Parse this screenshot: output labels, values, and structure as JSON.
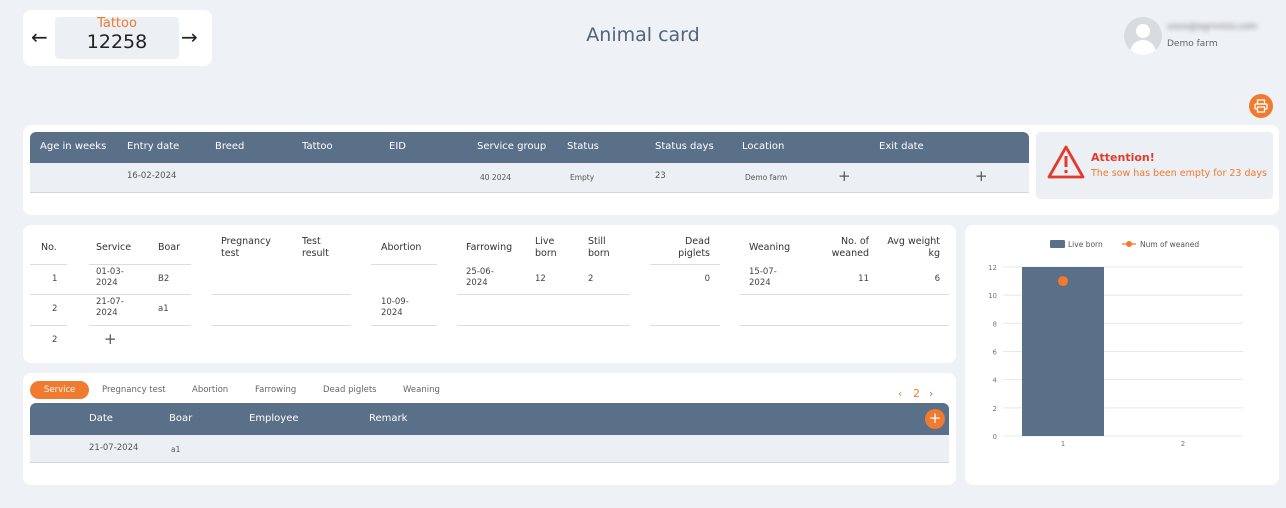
{
  "header": {
    "tattoo_label": "Tattoo",
    "tattoo_value": "12258",
    "title": "Animal card",
    "user_email": "xxxx@agrivisio.com",
    "farm": "Demo farm"
  },
  "info": {
    "columns": [
      "Age in weeks",
      "Entry date",
      "Breed",
      "Tattoo",
      "EID",
      "Service group",
      "Status",
      "Status days",
      "Location",
      "Exit date"
    ],
    "row": {
      "age": "",
      "entry_date": "16-02-2024",
      "breed": "",
      "tattoo": "",
      "eid": "",
      "service_group": "40 2024",
      "status": "Empty",
      "status_days": "23",
      "location": "Demo farm",
      "exit_date": ""
    }
  },
  "alert": {
    "title": "Attention!",
    "message": "The sow has been empty for 23 days"
  },
  "repro": {
    "headers": {
      "no": "No.",
      "service": "Service",
      "boar": "Boar",
      "pregnancy_test": "Pregnancy test",
      "test_result": "Test result",
      "abortion": "Abortion",
      "farrowing": "Farrowing",
      "live_born": "Live born",
      "still_born": "Still born",
      "dead_piglets": "Dead piglets",
      "weaning": "Weaning",
      "no_weaned": "No. of weaned",
      "avg_weight": "Avg weight kg"
    },
    "rows": [
      {
        "no": "1",
        "service": "01-03-2024",
        "boar": "B2",
        "abortion": "",
        "farrowing": "25-06-2024",
        "live_born": "12",
        "still_born": "2",
        "dead_piglets": "0",
        "weaning": "15-07-2024",
        "no_weaned": "11",
        "avg_weight": "6"
      },
      {
        "no": "2",
        "service": "21-07-2024",
        "boar": "a1",
        "abortion": "10-09-2024",
        "farrowing": "",
        "live_born": "",
        "still_born": "",
        "dead_piglets": "",
        "weaning": "",
        "no_weaned": "",
        "avg_weight": ""
      }
    ],
    "new_row_no": "2"
  },
  "events": {
    "tabs": [
      "Service",
      "Pregnancy test",
      "Abortion",
      "Farrowing",
      "Dead piglets",
      "Weaning"
    ],
    "active_tab": "Service",
    "page": "2",
    "columns": [
      "Date",
      "Boar",
      "Employee",
      "Remark"
    ],
    "row": {
      "date": "21-07-2024",
      "boar": "a1",
      "employee": "",
      "remark": ""
    }
  },
  "colors": {
    "accent": "#f07a2e",
    "header_bg": "#5a7089",
    "alert_red": "#e23b2c"
  },
  "chart_data": {
    "type": "bar",
    "categories": [
      "1",
      "2"
    ],
    "series": [
      {
        "name": "Live born",
        "type": "bar",
        "values": [
          12,
          null
        ],
        "color": "#5a7089"
      },
      {
        "name": "Num of weaned",
        "type": "scatter",
        "values": [
          11,
          null
        ],
        "color": "#f07a2e"
      }
    ],
    "ylim": [
      0,
      12
    ],
    "yticks": [
      0,
      2,
      4,
      6,
      8,
      10,
      12
    ],
    "legend": "top"
  }
}
